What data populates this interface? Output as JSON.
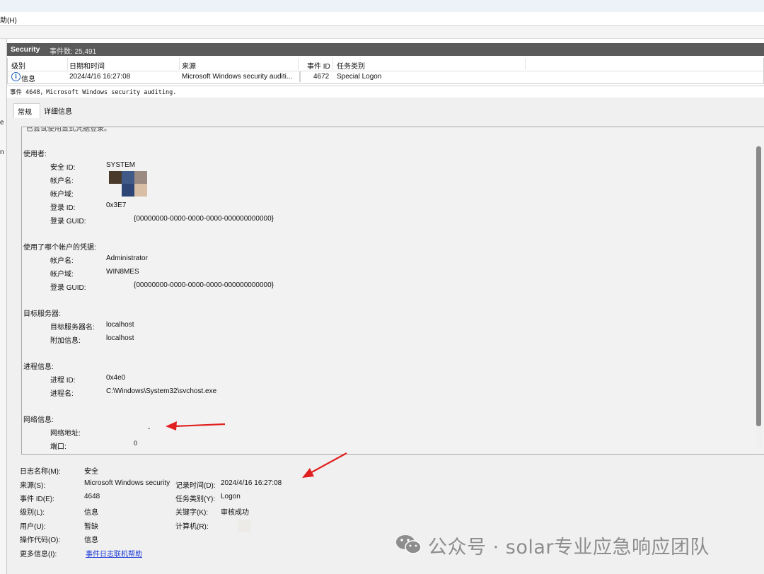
{
  "menubar": {
    "help_label": "助(H)"
  },
  "leftnav": {
    "stub_char_1": "e",
    "stub_char_2": "n"
  },
  "log": {
    "name": "Security",
    "event_count_label": "事件数: 25,491"
  },
  "event_table": {
    "columns": [
      "级别",
      "日期和时间",
      "来源",
      "事件 ID",
      "任务类别"
    ],
    "rows": [
      {
        "level": "信息",
        "datetime": "2024/4/16 16:27:08",
        "source": "Microsoft Windows security auditi...",
        "event_id": "4672",
        "task_category": "Special Logon"
      }
    ]
  },
  "detail": {
    "title": "事件 4648，Microsoft Windows security auditing.",
    "tabs": [
      "常规",
      "详细信息"
    ],
    "message": {
      "clipped_top": "已尝试使用显式凭据登录。",
      "subject_heading": "使用者:",
      "subject": {
        "security_id_label": "安全 ID:",
        "security_id": "SYSTEM",
        "account_name_label": "帐户名:",
        "account_domain_label": "帐户域:",
        "logon_id_label": "登录 ID:",
        "logon_id": "0x3E7",
        "logon_guid_label": "登录 GUID:",
        "logon_guid": "{00000000-0000-0000-0000-000000000000}"
      },
      "credentials_heading": "使用了哪个帐户的凭据:",
      "credentials": {
        "account_name_label": "帐户名:",
        "account_name": "Administrator",
        "account_domain_label": "帐户域:",
        "account_domain": "WIN8MES",
        "logon_guid_label": "登录 GUID:",
        "logon_guid": "{00000000-0000-0000-0000-000000000000}"
      },
      "target_heading": "目标服务器:",
      "target": {
        "server_name_label": "目标服务器名:",
        "server_name": "localhost",
        "additional_info_label": "附加信息:",
        "additional_info": "localhost"
      },
      "process_heading": "进程信息:",
      "process": {
        "process_id_label": "进程 ID:",
        "process_id": "0x4e0",
        "process_name_label": "进程名:",
        "process_name": "C:\\Windows\\System32\\svchost.exe"
      },
      "network_heading": "网络信息:",
      "network": {
        "address_label": "网络地址:",
        "address": "-",
        "port_label": "端口:",
        "port": "0"
      }
    },
    "properties": {
      "log_name_label": "日志名称(M):",
      "log_name": "安全",
      "source_label": "来源(S):",
      "source": "Microsoft Windows security",
      "logged_label": "记录时间(D):",
      "logged": "2024/4/16 16:27:08",
      "event_id_label": "事件 ID(E):",
      "event_id": "4648",
      "task_category_label": "任务类别(Y):",
      "task_category": "Logon",
      "level_label": "级别(L):",
      "level": "信息",
      "keywords_label": "关键字(K):",
      "keywords": "审核成功",
      "user_label": "用户(U):",
      "user": "暂缺",
      "computer_label": "计算机(R):",
      "opcode_label": "操作代码(O):",
      "opcode": "信息",
      "more_info_label": "更多信息(I):",
      "more_info_link": "事件日志联机帮助"
    }
  },
  "watermark": {
    "text": "公众号 · solar专业应急响应团队",
    "icon": "wechat-icon"
  },
  "colors": {
    "header_bg": "#5a5a5a",
    "arrow": "#e02020",
    "link": "#1a38d6",
    "panel_bg": "#f0f0f0"
  },
  "redaction_colors": [
    "#4a3a2a",
    "#3f5a86",
    "#9b8a82",
    "#2e4676",
    "#d7bea5"
  ]
}
